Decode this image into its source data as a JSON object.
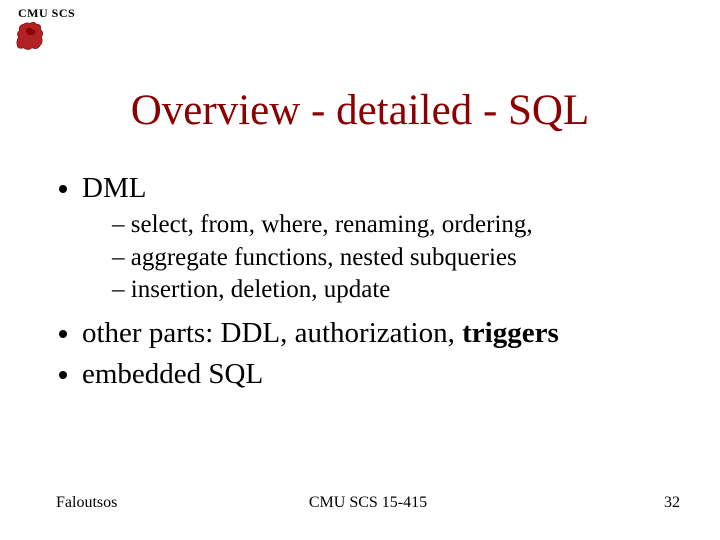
{
  "header": {
    "brand": "CMU SCS"
  },
  "title": "Overview - detailed - SQL",
  "bullets": {
    "b1": "DML",
    "b1_sub1": "select, from, where, renaming, ordering,",
    "b1_sub2": " aggregate functions, nested subqueries",
    "b1_sub3": "insertion, deletion, update",
    "b2_pre": "other parts: DDL, authorization, ",
    "b2_bold": "triggers",
    "b3": "embedded SQL"
  },
  "footer": {
    "left": "Faloutsos",
    "center": "CMU SCS 15-415",
    "right": "32"
  }
}
